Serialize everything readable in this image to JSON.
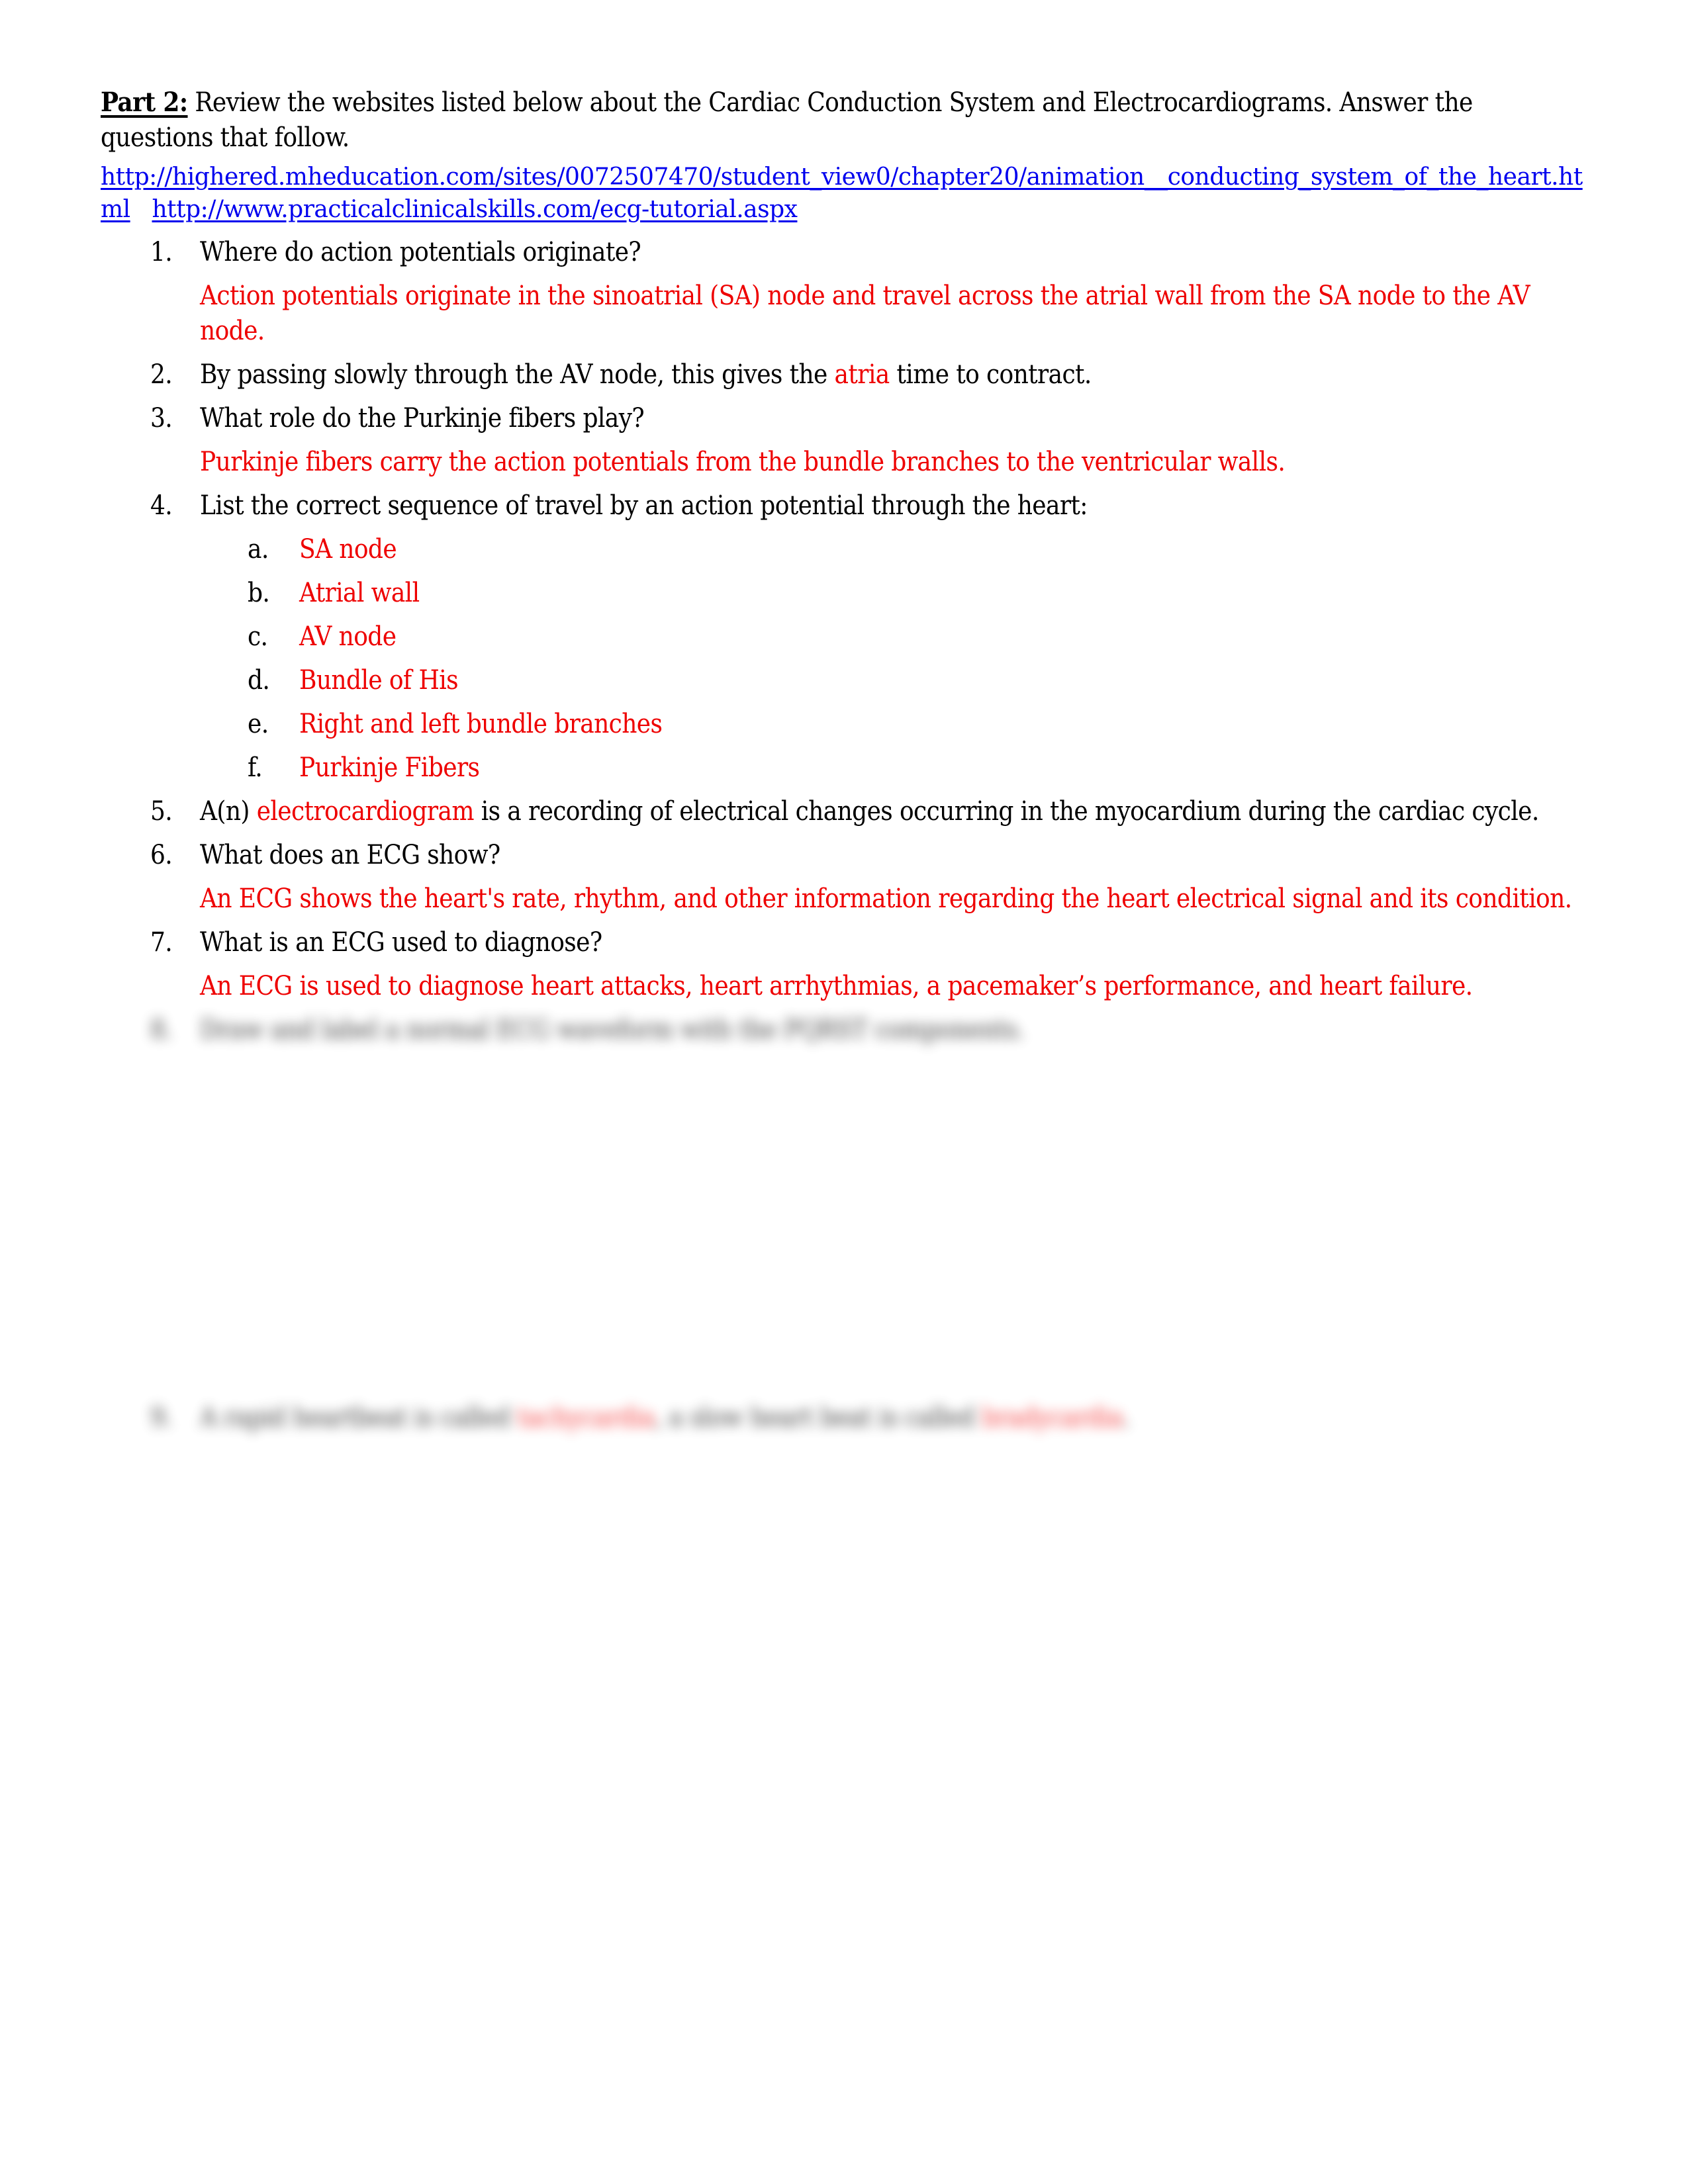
{
  "document": {
    "intro": {
      "part_label": "Part 2:",
      "text": " Review the websites listed below about the Cardiac Conduction System and Electrocardiograms.   Answer the questions that follow."
    },
    "links": [
      "http://highered.mheducation.com/sites/0072507470/student_view0/chapter20/animation__conducting_system_of_the_heart.html",
      "http://www.practicalclinicalskills.com/ecg-tutorial.aspx"
    ],
    "colors": {
      "answer": "#ee0000",
      "link": "#0000ee",
      "text": "#000000"
    },
    "questions": [
      {
        "number": "1.",
        "prompt": "Where do action potentials originate?",
        "answer": "Action potentials originate in the sinoatrial (SA) node and travel across the atrial wall from the SA node to the AV node."
      },
      {
        "number": "2.",
        "prompt_before": "By passing slowly through the AV node, this gives the ",
        "fill": "atria",
        "prompt_after": " time to contract."
      },
      {
        "number": "3.",
        "prompt": "What role do the Purkinje fibers play?",
        "answer": "Purkinje fibers carry the action potentials from the bundle branches to the ventricular walls."
      },
      {
        "number": "4.",
        "prompt": "List the correct sequence of travel by an action potential through the heart:",
        "sequence": [
          {
            "letter": "a.",
            "value": "SA node"
          },
          {
            "letter": "b.",
            "value": "Atrial wall"
          },
          {
            "letter": "c.",
            "value": "AV node"
          },
          {
            "letter": "d.",
            "value": "Bundle of His"
          },
          {
            "letter": "e.",
            "value": "Right and left bundle branches"
          },
          {
            "letter": "f.",
            "value": "Purkinje Fibers"
          }
        ]
      },
      {
        "number": "5.",
        "prompt_before": "A(n) ",
        "fill": "electrocardiogram",
        "prompt_after": " is a recording of electrical changes occurring in the myocardium during the cardiac cycle."
      },
      {
        "number": "6.",
        "prompt": "What does an ECG show?",
        "answer": "An ECG shows the heart's rate, rhythm, and other information regarding the heart electrical signal and its condition."
      },
      {
        "number": "7.",
        "prompt": "What is an ECG used to diagnose?",
        "answer": "An ECG is used to diagnose heart attacks, heart arrhythmias, a pacemaker’s performance, and heart failure."
      },
      {
        "number": "8.",
        "prompt": "Draw and label a normal ECG waveform with the PQRST components.",
        "blurred": true
      },
      {
        "number": "9.",
        "prompt_before": "A rapid heartbeat is called ",
        "fill": "tachycardia",
        "prompt_middle": ", a slow heart beat is called ",
        "fill2": "bradycardia",
        "prompt_after": ".",
        "blurred": true
      }
    ]
  }
}
